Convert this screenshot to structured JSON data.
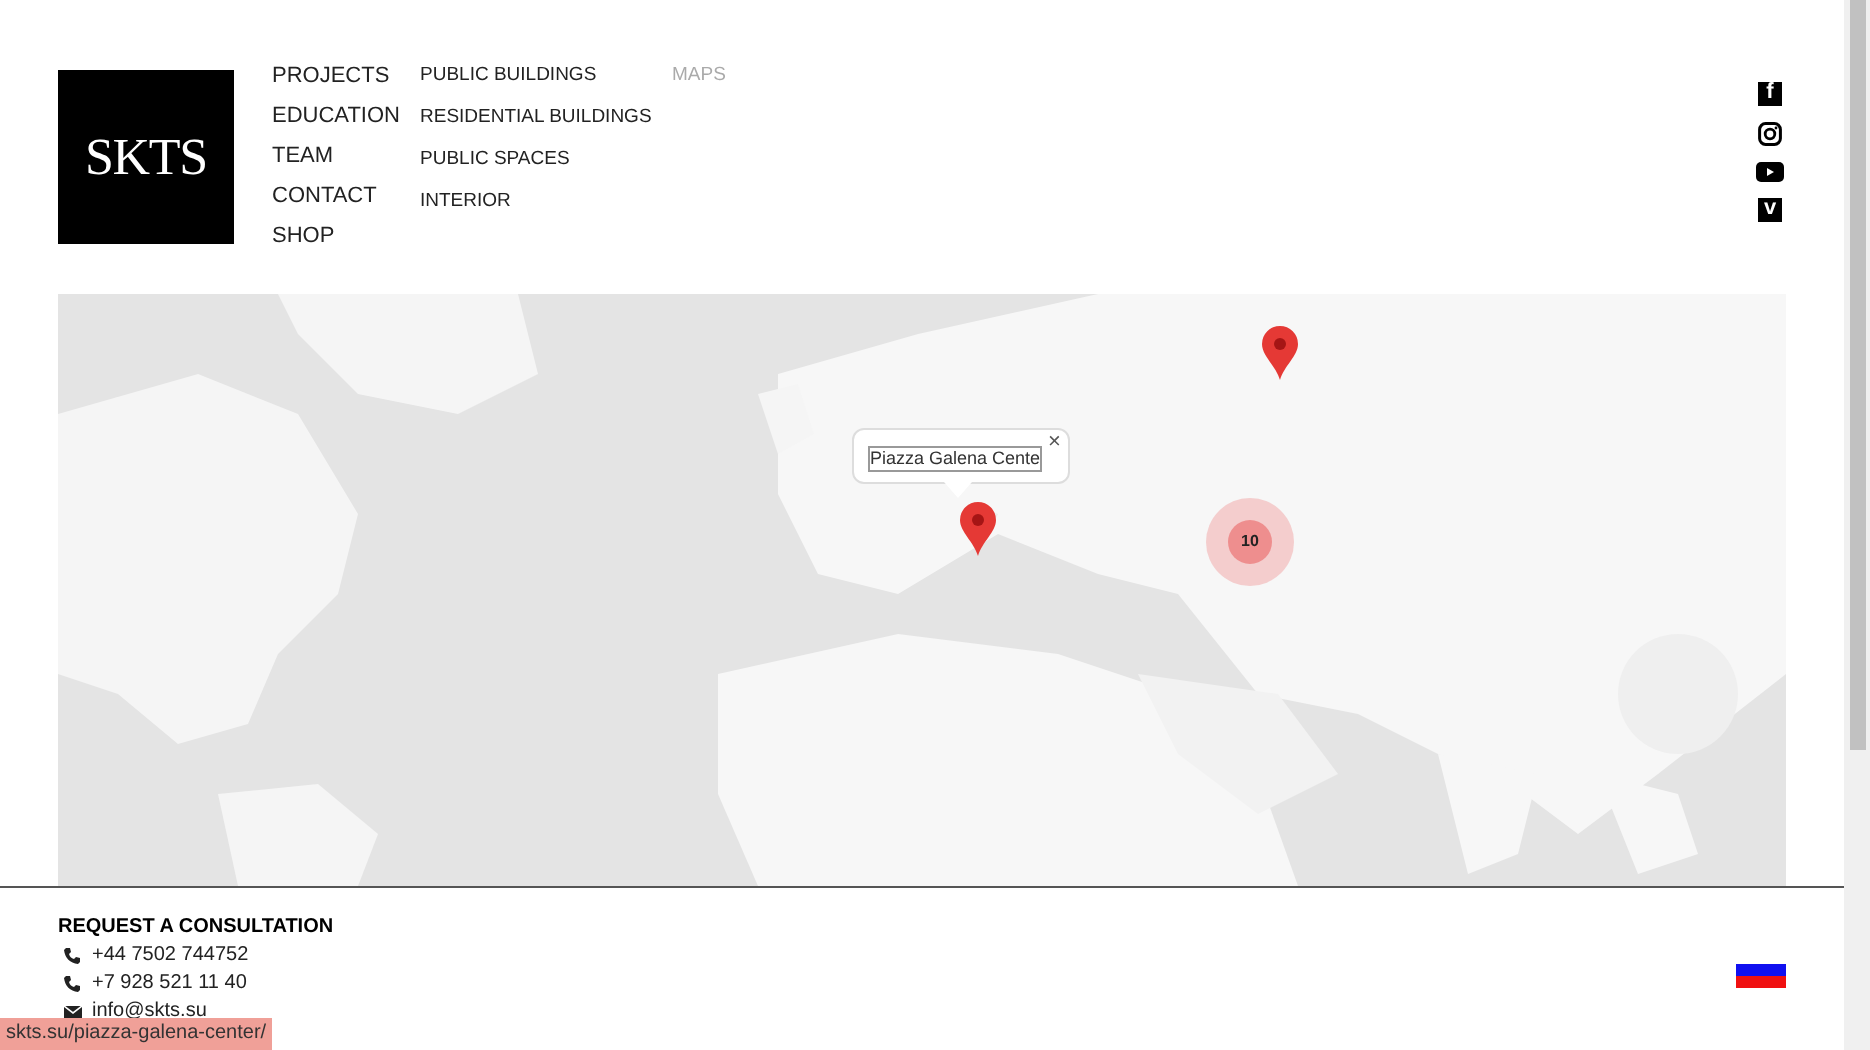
{
  "logo": {
    "text": "SKTS"
  },
  "menu": [
    {
      "label": "PROJECTS"
    },
    {
      "label": "EDUCATION"
    },
    {
      "label": "TEAM"
    },
    {
      "label": "CONTACT"
    },
    {
      "label": "SHOP"
    }
  ],
  "submenu": [
    {
      "label": "PUBLIC BUILDINGS"
    },
    {
      "label": "RESIDENTIAL BUILDINGS"
    },
    {
      "label": "PUBLIC SPACES"
    },
    {
      "label": "INTERIOR"
    }
  ],
  "view_links": [
    {
      "label": "MAPS",
      "selected": true
    }
  ],
  "social": [
    {
      "kind": "letter",
      "glyph": "f"
    },
    {
      "kind": "camera"
    },
    {
      "kind": "play"
    },
    {
      "kind": "letter",
      "glyph": "v"
    }
  ],
  "map": {
    "kind": "picture",
    "markers": [
      {
        "kind": "pin"
      },
      {
        "kind": "pin"
      },
      {
        "kind": "cluster",
        "count": "10"
      }
    ],
    "popup": {
      "text": "Piazza Galena Cente",
      "close": "×"
    }
  },
  "footer": {
    "title": "REQUEST A CONSULTATION",
    "contacts": [
      {
        "kind": "phone",
        "text": "+44 7502 744752"
      },
      {
        "kind": "phone",
        "text": "+7 928 521 11 40"
      },
      {
        "kind": "mail",
        "text": "info@skts.su"
      }
    ]
  },
  "status_bar": {
    "url": "skts.su/piazza-galena-center/"
  }
}
